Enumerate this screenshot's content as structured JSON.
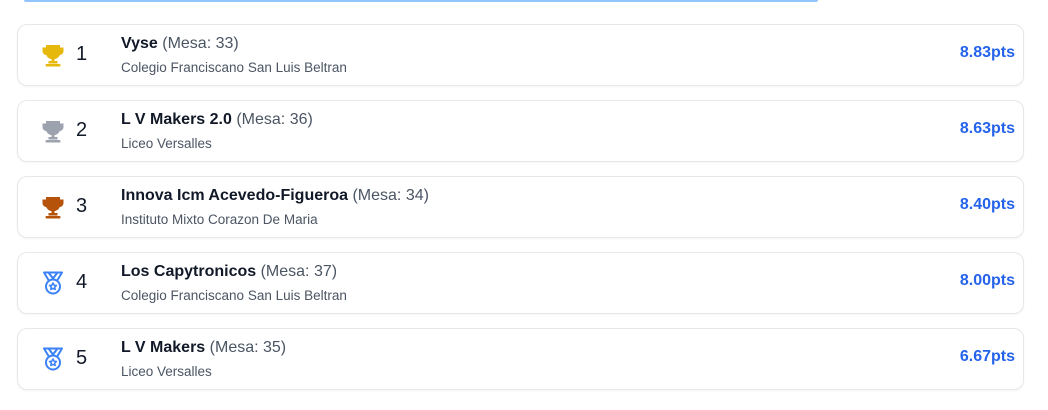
{
  "colors": {
    "gold": "#e7b80c",
    "silver": "#9ca3af",
    "bronze": "#b45309",
    "medal": "#3b82f6",
    "score": "#2563eb",
    "progress": "#93c5fd"
  },
  "ranking": [
    {
      "icon": "trophy-gold-icon",
      "rank": "1",
      "name": "Vyse",
      "mesa": "(Mesa: 33)",
      "school": "Colegio Franciscano San Luis Beltran",
      "score": "8.83pts"
    },
    {
      "icon": "trophy-silver-icon",
      "rank": "2",
      "name": "L V Makers 2.0",
      "mesa": "(Mesa: 36)",
      "school": "Liceo Versalles",
      "score": "8.63pts"
    },
    {
      "icon": "trophy-bronze-icon",
      "rank": "3",
      "name": "Innova Icm Acevedo-Figueroa",
      "mesa": "(Mesa: 34)",
      "school": "Instituto Mixto Corazon De Maria",
      "score": "8.40pts"
    },
    {
      "icon": "medal-icon",
      "rank": "4",
      "name": "Los Capytronicos",
      "mesa": "(Mesa: 37)",
      "school": "Colegio Franciscano San Luis Beltran",
      "score": "8.00pts"
    },
    {
      "icon": "medal-icon",
      "rank": "5",
      "name": "L V Makers",
      "mesa": "(Mesa: 35)",
      "school": "Liceo Versalles",
      "score": "6.67pts"
    }
  ]
}
